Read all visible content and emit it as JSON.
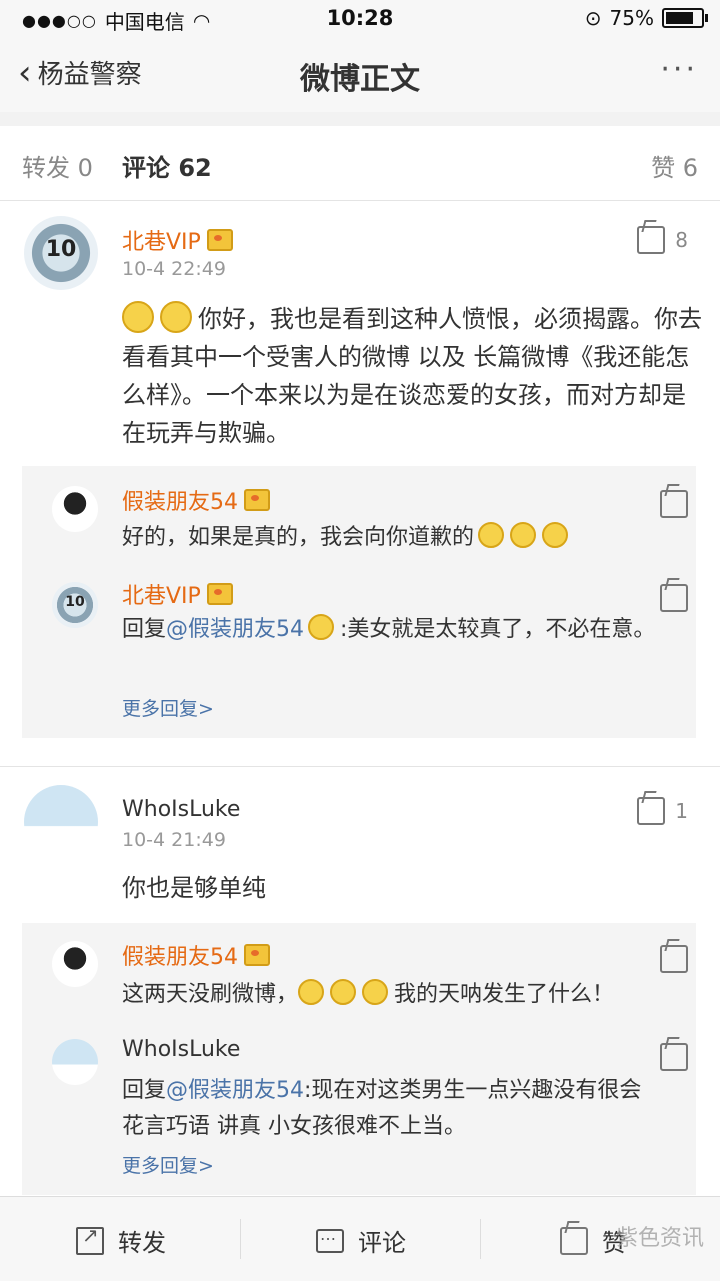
{
  "status": {
    "carrier": "中国电信",
    "time": "10:28",
    "battery": "75%"
  },
  "nav": {
    "back_label": "杨益警察",
    "title": "微博正文",
    "more": "···"
  },
  "tabs": {
    "repost": "转发 0",
    "comments": "评论 62",
    "likes": "赞 6"
  },
  "comment1": {
    "user": "北巷VIP",
    "time": "10-4 22:49",
    "likes": "8",
    "text": "你好，我也是看到这种人愤恨，必须揭露。你去看看其中一个受害人的微博 以及 长篇微博《我还能怎么样》。一个本来以为是在谈恋爱的女孩，而对方却是在玩弄与欺骗。",
    "replies": [
      {
        "user": "假装朋友54",
        "text": "好的，如果是真的，我会向你道歉的"
      },
      {
        "user": "北巷VIP",
        "prefix": "回复",
        "mention": "@假装朋友54",
        "text": ":美女就是太较真了，不必在意。"
      }
    ],
    "more": "更多回复>"
  },
  "comment2": {
    "user": "WhoIsLuke",
    "time": "10-4 21:49",
    "likes": "1",
    "text": "你也是够单纯",
    "replies": [
      {
        "user": "假装朋友54",
        "text": "这两天没刷微博，",
        "text2": "我的天呐发生了什么！"
      },
      {
        "user": "WhoIsLuke",
        "prefix": "回复",
        "mention": "@假装朋友54",
        "text": ":现在对这类男生一点兴趣没有很会花言巧语 讲真 小女孩很难不上当。"
      }
    ],
    "more": "更多回复>"
  },
  "bottom": {
    "repost": "转发",
    "comment": "评论",
    "like": "赞"
  },
  "watermark": "紫色资讯"
}
